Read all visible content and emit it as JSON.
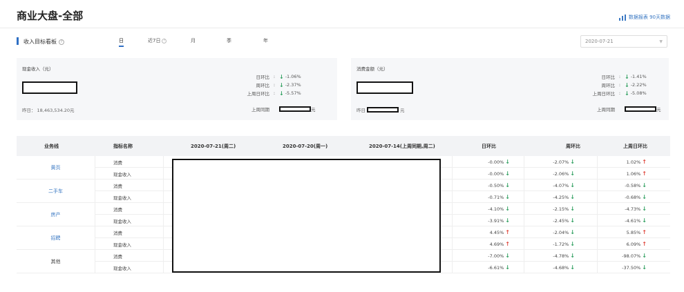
{
  "page": {
    "title": "商业大盘-全部",
    "top_link": "数据报表 90天数据"
  },
  "section": {
    "title": "收入目标看板",
    "date": "2020-07-21"
  },
  "tabs": [
    {
      "label": "日",
      "active": true
    },
    {
      "label": "近7日",
      "active": false
    },
    {
      "label": "月",
      "active": false
    },
    {
      "label": "季",
      "active": false
    },
    {
      "label": "年",
      "active": false
    }
  ],
  "cards": {
    "left": {
      "label": "现金收入（元）",
      "foot_label": "昨日：",
      "foot_value": "18,463,534.20元",
      "stats": [
        {
          "label": "日环比",
          "value": "-1.06%"
        },
        {
          "label": "周环比",
          "value": "-2.37%"
        },
        {
          "label": "上周日环比",
          "value": "-5.57%"
        }
      ],
      "last_week_label": "上周同期",
      "last_week_unit": "元"
    },
    "right": {
      "label": "消费金额（元）",
      "foot_label": "昨日",
      "foot_unit": "元",
      "stats": [
        {
          "label": "日环比",
          "value": "-1.41%"
        },
        {
          "label": "周环比",
          "value": "-2.22%"
        },
        {
          "label": "上周日环比",
          "value": "-5.08%"
        }
      ],
      "last_week_label": "上周同期",
      "last_week_unit": "元"
    }
  },
  "table": {
    "headers": [
      "业务线",
      "指标名称",
      "2020-07-21(周二)",
      "2020-07-20(周一)",
      "2020-07-14(上周同期,周二)",
      "日环比",
      "周环比",
      "上周日环比"
    ],
    "groups": [
      {
        "name": "黄页",
        "link": true,
        "rows": [
          {
            "metric": "消费",
            "day": "-0.00%",
            "day_dir": "down",
            "week": "-2.07%",
            "week_dir": "down",
            "lw": "1.02%",
            "lw_dir": "up"
          },
          {
            "metric": "现金收入",
            "day": "-0.00%",
            "day_dir": "down",
            "week": "-2.06%",
            "week_dir": "down",
            "lw": "1.06%",
            "lw_dir": "up"
          }
        ]
      },
      {
        "name": "二手车",
        "link": true,
        "rows": [
          {
            "metric": "消费",
            "day": "-0.50%",
            "day_dir": "down",
            "week": "-4.07%",
            "week_dir": "down",
            "lw": "-0.58%",
            "lw_dir": "down"
          },
          {
            "metric": "现金收入",
            "day": "-0.71%",
            "day_dir": "down",
            "week": "-4.25%",
            "week_dir": "down",
            "lw": "-0.68%",
            "lw_dir": "down"
          }
        ]
      },
      {
        "name": "房产",
        "link": true,
        "rows": [
          {
            "metric": "消费",
            "day": "-4.10%",
            "day_dir": "down",
            "week": "-2.15%",
            "week_dir": "down",
            "lw": "-4.73%",
            "lw_dir": "down"
          },
          {
            "metric": "现金收入",
            "day": "-3.91%",
            "day_dir": "down",
            "week": "-2.45%",
            "week_dir": "down",
            "lw": "-4.61%",
            "lw_dir": "down"
          }
        ]
      },
      {
        "name": "招聘",
        "link": true,
        "rows": [
          {
            "metric": "消费",
            "day": "4.45%",
            "day_dir": "up",
            "week": "-2.04%",
            "week_dir": "down",
            "lw": "5.85%",
            "lw_dir": "up"
          },
          {
            "metric": "现金收入",
            "day": "4.69%",
            "day_dir": "up",
            "week": "-1.72%",
            "week_dir": "down",
            "lw": "6.09%",
            "lw_dir": "up"
          }
        ]
      },
      {
        "name": "其他",
        "link": false,
        "rows": [
          {
            "metric": "消费",
            "day": "-7.00%",
            "day_dir": "down",
            "week": "-4.78%",
            "week_dir": "down",
            "lw": "-98.07%",
            "lw_dir": "down"
          },
          {
            "metric": "现金收入",
            "day": "-6.61%",
            "day_dir": "down",
            "week": "-4.68%",
            "week_dir": "down",
            "lw": "-37.50%",
            "lw_dir": "down"
          }
        ]
      }
    ]
  },
  "colors": {
    "accent": "#2e6fc4",
    "down": "#2a9d5c",
    "up": "#e0453a",
    "link": "#3a78c3"
  },
  "icons": {
    "top_link": "bar-chart-icon",
    "help": "help-circle-icon",
    "date_picker": "chevron-down-icon"
  }
}
